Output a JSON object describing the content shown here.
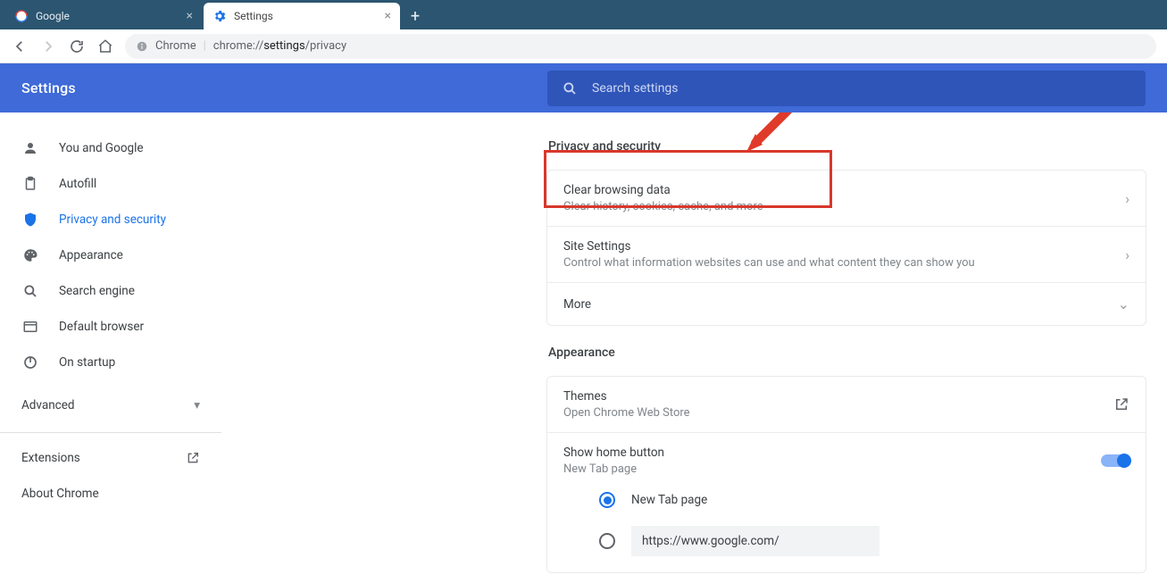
{
  "tabs": [
    {
      "title": "Google",
      "active": false
    },
    {
      "title": "Settings",
      "active": true
    }
  ],
  "url": {
    "prefix": "Chrome",
    "path_pre": "chrome://",
    "path_bold": "settings",
    "path_post": "/privacy"
  },
  "header": {
    "title": "Settings"
  },
  "search": {
    "placeholder": "Search settings"
  },
  "sidebar": {
    "items": [
      {
        "label": "You and Google",
        "icon": "person"
      },
      {
        "label": "Autofill",
        "icon": "clipboard"
      },
      {
        "label": "Privacy and security",
        "icon": "shield",
        "active": true
      },
      {
        "label": "Appearance",
        "icon": "palette"
      },
      {
        "label": "Search engine",
        "icon": "search"
      },
      {
        "label": "Default browser",
        "icon": "browser"
      },
      {
        "label": "On startup",
        "icon": "power"
      }
    ],
    "advanced": "Advanced",
    "extensions": "Extensions",
    "about": "About Chrome"
  },
  "sections": {
    "privacy": {
      "title": "Privacy and security",
      "rows": [
        {
          "title": "Clear browsing data",
          "sub": "Clear history, cookies, cache, and more"
        },
        {
          "title": "Site Settings",
          "sub": "Control what information websites can use and what content they can show you"
        },
        {
          "title": "More"
        }
      ]
    },
    "appearance": {
      "title": "Appearance",
      "themes": {
        "title": "Themes",
        "sub": "Open Chrome Web Store"
      },
      "home": {
        "title": "Show home button",
        "sub": "New Tab page"
      },
      "radios": {
        "newtab": "New Tab page",
        "url_value": "https://www.google.com/"
      }
    }
  }
}
